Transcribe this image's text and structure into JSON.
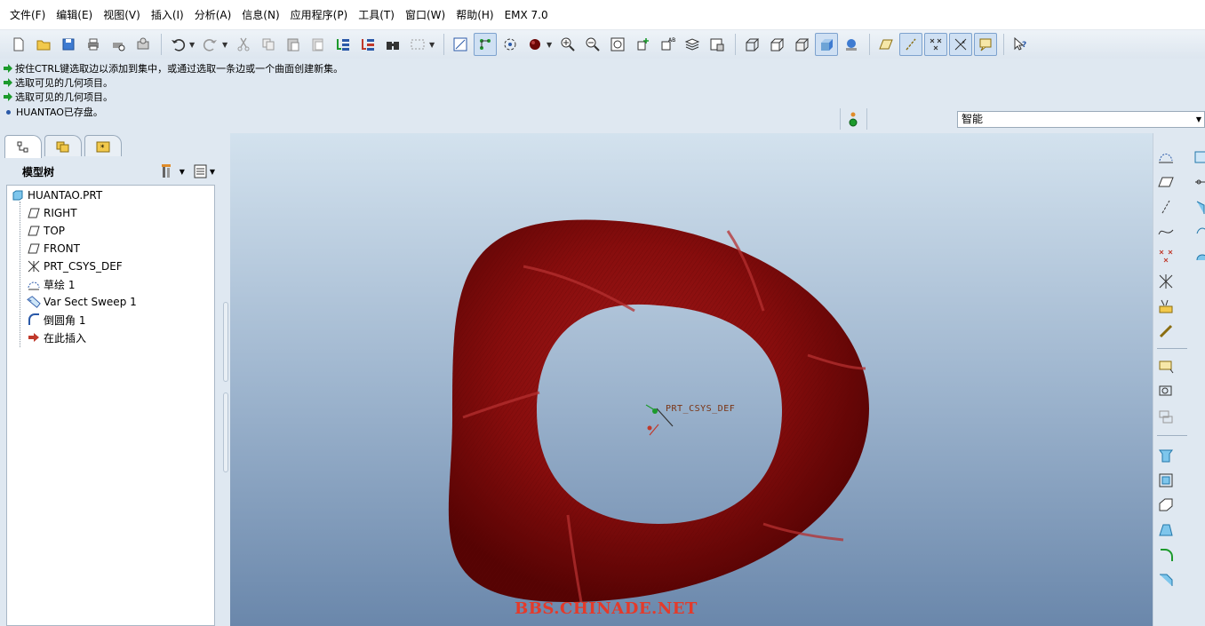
{
  "menu": [
    "文件(F)",
    "编辑(E)",
    "视图(V)",
    "插入(I)",
    "分析(A)",
    "信息(N)",
    "应用程序(P)",
    "工具(T)",
    "窗口(W)",
    "帮助(H)",
    "EMX 7.0"
  ],
  "messages": [
    {
      "text": "按住CTRL键选取边以添加到集中，或通过选取一条边或一个曲面创建新集。",
      "icon": "green-arrow-icon"
    },
    {
      "text": "选取可见的几何项目。",
      "icon": "green-arrow-icon"
    },
    {
      "text": "选取可见的几何项目。",
      "icon": "green-arrow-icon"
    },
    {
      "text": "HUANTAO已存盘。",
      "icon": "blue-dot-icon"
    }
  ],
  "filter": {
    "value": "智能"
  },
  "model_tree": {
    "title": "模型树",
    "root": "HUANTAO.PRT",
    "items": [
      {
        "label": "RIGHT",
        "icon": "datum-plane-icon"
      },
      {
        "label": "TOP",
        "icon": "datum-plane-icon"
      },
      {
        "label": "FRONT",
        "icon": "datum-plane-icon"
      },
      {
        "label": "PRT_CSYS_DEF",
        "icon": "coordinate-system-icon"
      },
      {
        "label": "草绘 1",
        "icon": "sketch-icon"
      },
      {
        "label": "Var Sect Sweep 1",
        "icon": "sweep-icon"
      },
      {
        "label": "倒圆角 1",
        "icon": "round-icon"
      },
      {
        "label": "在此插入",
        "icon": "insert-here-arrow-icon"
      }
    ]
  },
  "viewport": {
    "csys_label": "PRT_CSYS_DEF",
    "watermark": "BBS.CHINADE.NET",
    "model_color": "#8a0c0c",
    "background_top": "#d3e2ee",
    "background_bottom": "#6a87ab"
  },
  "colors": {
    "accent": "#2a59a8",
    "message_arrow": "#1c9a2c"
  }
}
